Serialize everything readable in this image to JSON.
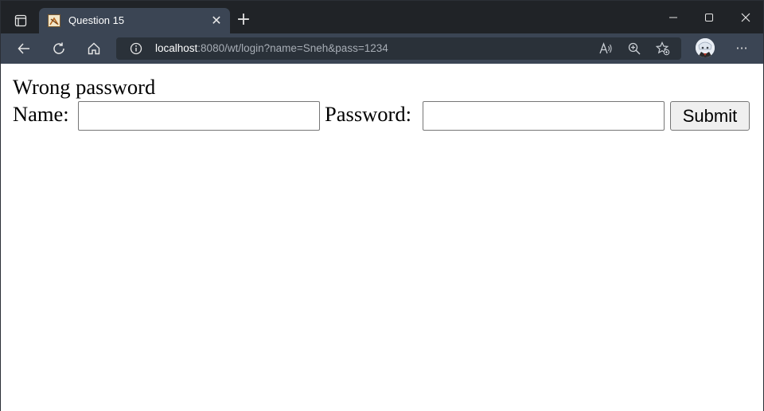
{
  "browser": {
    "tab": {
      "title": "Question 15",
      "close_glyph": "✕",
      "favicon": "page-favicon-icon"
    },
    "new_tab_glyph": "+",
    "window_controls": [
      "minimize-icon",
      "maximize-icon",
      "close-icon"
    ],
    "toolbar": {
      "buttons": [
        "back-icon",
        "refresh-icon",
        "home-icon"
      ],
      "url": {
        "host": "localhost",
        "rest": ":8080/wt/login?name=Sneh&pass=1234"
      },
      "url_icons": [
        "read-aloud-icon",
        "zoom-icon",
        "favorites-icon"
      ],
      "more_glyph": "···"
    },
    "colors": {
      "titlebar": "#202327",
      "tab_active": "#3b4554",
      "toolbar": "#3b4554",
      "urlbar": "#2a3139"
    }
  },
  "page": {
    "message": "Wrong password",
    "form": {
      "name_label": "Name:",
      "name_value": "",
      "password_label": "Password:",
      "password_value": "",
      "submit_label": "Submit"
    }
  }
}
